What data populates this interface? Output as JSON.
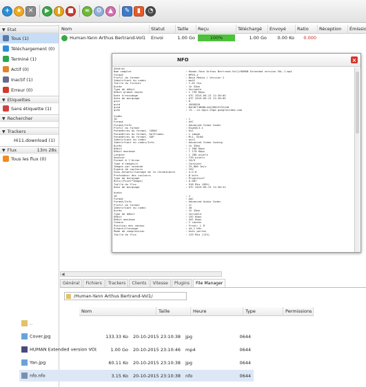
{
  "toolbar": {
    "buttons": [
      {
        "icon": "add-torrent-icon",
        "color": "#2a8ed6"
      },
      {
        "icon": "favorite-star-icon",
        "color": "#f1a81f"
      },
      {
        "icon": "remove-x-icon",
        "color": "#8a8a8a"
      },
      {
        "icon": "start-icon",
        "color": "#3aa845"
      },
      {
        "icon": "pause-icon",
        "color": "#e3a219"
      },
      {
        "icon": "stop-icon",
        "color": "#d23a2e"
      },
      {
        "icon": "rss-icon",
        "color": "#6fb83a"
      },
      {
        "icon": "settings-icon",
        "color": "#8fb0d8"
      },
      {
        "icon": "queue-up-icon",
        "color": "#d26fb0"
      },
      {
        "icon": "tools-icon",
        "color": "#3f7ac9"
      },
      {
        "icon": "info-icon",
        "color": "#e95a2a"
      },
      {
        "icon": "about-icon",
        "color": "#4a4a4a"
      }
    ]
  },
  "sidebar": {
    "etat": "Etat",
    "status_items": [
      {
        "label": "Tous (1)",
        "color": "#5a78a8"
      },
      {
        "label": "Téléchargement (0)",
        "color": "#2d8ed8"
      },
      {
        "label": "Terminé (1)",
        "color": "#2aa84a"
      },
      {
        "label": "Actif (0)",
        "color": "#e3842a"
      },
      {
        "label": "Inactif (1)",
        "color": "#6a6a8a"
      },
      {
        "label": "Erreur (0)",
        "color": "#d33a2a"
      }
    ],
    "etiquettes": "Etiquettes",
    "label_items": [
      {
        "label": "Sans étiquette (1)",
        "color": "#d04040"
      }
    ],
    "rechercher": "Rechercher",
    "trackers": "Trackers",
    "tracker_items": [
      {
        "label": "Hi11.download (1)"
      }
    ],
    "flux": "Flux",
    "flux_time": "13m 28s",
    "flux_items": [
      {
        "label": "Tous les flux (0)",
        "color": "#f08a22"
      }
    ]
  },
  "torrent_table": {
    "headers": [
      "Nom",
      "Statut",
      "Taille",
      "Reçu",
      "Téléchargé",
      "Envoyé",
      "Ratio",
      "Réception",
      "Émission"
    ],
    "row": {
      "name": "Human-Yann Arthus Bertrand-Vol1",
      "status": "Envoi",
      "size": "1.00 Go",
      "received": "100%",
      "downloaded": "1.00 Go",
      "sent": "0.00 Ko",
      "ratio": "0.000"
    },
    "progress_fraction": 1.0,
    "colors": {
      "progress": "#4dc13b",
      "ratio": "#d02020"
    }
  },
  "nfo_window": {
    "title": "NFO",
    "close": "×",
    "lines": [
      [
        "Général",
        ""
      ],
      [
        "Nom complet",
        ": Human-Yann Arthus Bertrand-Vol1/HUMAN Extended version VOL.1.mp4"
      ],
      [
        "Format",
        ": MPEG-4"
      ],
      [
        "Profil du format",
        ": Base Media / Version 2"
      ],
      [
        "Identifiant du codec",
        ": mp42"
      ],
      [
        "Taille du fichier",
        ": 1.01 Gio"
      ],
      [
        "Durée",
        ": 1h 33mn"
      ],
      [
        "Type de débit",
        ": Variable"
      ],
      [
        "Débit global moyen",
        ": 1 739 Kbps"
      ],
      [
        "Date d'encodage",
        ": UTC 2015-09-13 11:30:05"
      ],
      [
        "Date de marquage",
        ": UTC 2015-09-13 11:30:05"
      ],
      [
        "gsst",
        ": 0"
      ],
      [
        "gstd",
        ": 4999928"
      ],
      [
        "gssd",
        ": B4C0F74B9BL44229823732140"
      ],
      [
        "gshh",
        ": r5---sn-4gxx-25ge.googlevideo.com"
      ],
      [
        "",
        ""
      ],
      [
        "Vidéo",
        ""
      ],
      [
        "ID",
        ": 1"
      ],
      [
        "Format",
        ": AVC"
      ],
      [
        "Format/Info",
        ": Advanced Video Codec"
      ],
      [
        "Profil du format",
        ": High@L3.1"
      ],
      [
        "Paramètres du format, CABAC",
        ": Oui"
      ],
      [
        "Paramètres du format, RefFrames",
        ": 1 image"
      ],
      [
        "Paramètres du format, GOP",
        ": M=1, N=60"
      ],
      [
        "Identifiant du codec",
        ": avc1"
      ],
      [
        "Identifiant du codec/Info",
        ": Advanced Video Coding"
      ],
      [
        "Durée",
        ": 1h 33mn"
      ],
      [
        "Débit",
        ": 1 500 Kbps"
      ],
      [
        "Débit maximum",
        ": 7 179 Kbps"
      ],
      [
        "Largeur",
        ": 1 280 pixels"
      ],
      [
        "Hauteur",
        ": 720 pixels"
      ],
      [
        "Format à l'écran",
        ": 16/9"
      ],
      [
        "Type d'images/s",
        ": Constant"
      ],
      [
        "Images par seconde",
        ": 25,000 Im/s"
      ],
      [
        "Espace de couleurs",
        ": YUV"
      ],
      [
        "Sous-échantillonnage de la chrominance",
        ": 4:2:0"
      ],
      [
        "Profondeur des couleurs",
        ": 8 bits"
      ],
      [
        "Type de balayage",
        ": Progressif"
      ],
      [
        "Bits/(Pixel*Image)",
        ": 0.067"
      ],
      [
        "Taille du flux",
        ": 916 Mio (89%)"
      ],
      [
        "Date de marquage",
        ": UTC 2015-09-13 11:30:51"
      ],
      [
        "",
        ""
      ],
      [
        "Audio",
        ""
      ],
      [
        "ID",
        ": 2"
      ],
      [
        "Format",
        ": AAC"
      ],
      [
        "Format/Info",
        ": Advanced Audio Codec"
      ],
      [
        "Profil du format",
        ": LC"
      ],
      [
        "Identifiant du codec",
        ": 40"
      ],
      [
        "Durée",
        ": 1h 33mn"
      ],
      [
        "Type de débit",
        ": Variable"
      ],
      [
        "Débit",
        ": 192 Kbps"
      ],
      [
        "Débit maximum",
        ": 201 Kbps"
      ],
      [
        "Canaux",
        ": 2 canaux"
      ],
      [
        "Position des canaux",
        ": Front: L R"
      ],
      [
        "Échantillonnage",
        ": 44,1 KHz"
      ],
      [
        "Mode de compression",
        ": Avec pertes"
      ],
      [
        "Taille du flux",
        ": 129 Mio (12%)"
      ]
    ]
  },
  "detail_tabs": [
    "Général",
    "Fichiers",
    "Trackers",
    "Clients",
    "Vitesse",
    "Plugins",
    "File Manager"
  ],
  "file_manager": {
    "path": "/Human-Yann Arthus Bertrand-Vol1/",
    "headers": [
      "Nom",
      "Taille",
      "Heure",
      "Type",
      "Permissions"
    ],
    "rows": [
      {
        "name": "..",
        "size": "",
        "time": "",
        "type": "",
        "perm": "",
        "icon_color": "#e0c26a"
      },
      {
        "name": "Cover.jpg",
        "size": "133.33 Ko",
        "time": "20-10-2015 23:10:38",
        "type": "jpg",
        "perm": "0644",
        "icon_color": "#6aa3d8"
      },
      {
        "name": "HUMAN Extended version VOL.1.mp4",
        "size": "1.00 Go",
        "time": "20-10-2015 23:10:46",
        "type": "mp4",
        "perm": "0644",
        "icon_color": "#4a4a7a"
      },
      {
        "name": "Yan.jpg",
        "size": "60.11 Ko",
        "time": "20-10-2015 23:10:38",
        "type": "jpg",
        "perm": "0644",
        "icon_color": "#6aa3d8"
      },
      {
        "name": "nfo.nfo",
        "size": "3.15 Ko",
        "time": "20-10-2015 23:10:38",
        "type": "nfo",
        "perm": "0644",
        "icon_color": "#7a8fb0"
      }
    ]
  }
}
